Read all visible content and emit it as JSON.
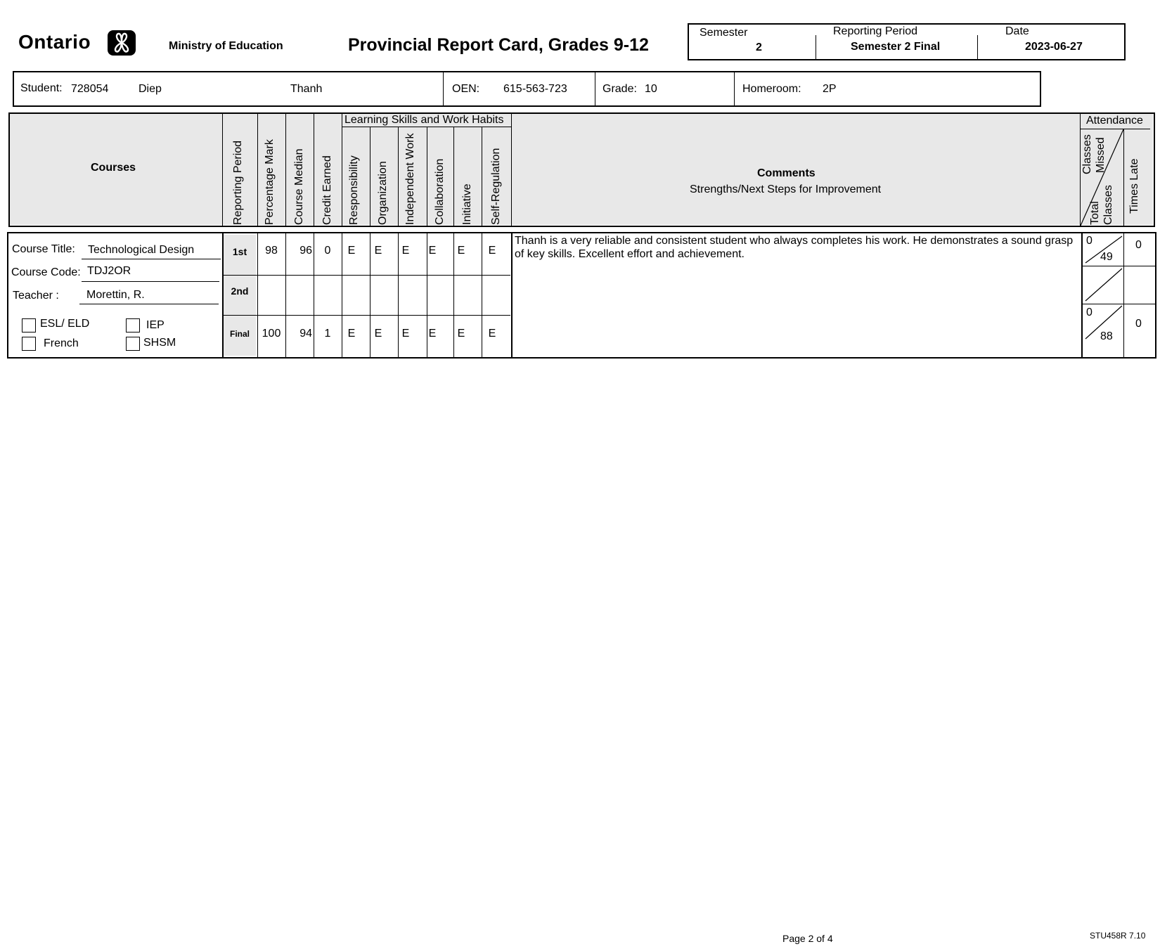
{
  "header": {
    "logo_text": "Ontario",
    "ministry": "Ministry of Education",
    "title": "Provincial Report Card, Grades 9-12",
    "semester_label": "Semester",
    "semester_value": "2",
    "period_label": "Reporting Period",
    "period_value": "Semester 2 Final",
    "date_label": "Date",
    "date_value": "2023-06-27"
  },
  "student": {
    "student_label": "Student:",
    "student_number": "728054",
    "last_name": "Diep",
    "first_name": "Thanh",
    "oen_label": "OEN:",
    "oen_value": "615-563-723",
    "grade_label": "Grade:",
    "grade_value": "10",
    "homeroom_label": "Homeroom:",
    "homeroom_value": "2P"
  },
  "table_header": {
    "courses": "Courses",
    "reporting_period": "Reporting Period",
    "percentage_mark": "Percentage Mark",
    "course_median": "Course Median",
    "credit_earned": "Credit Earned",
    "learning_skills": "Learning Skills and Work Habits",
    "skills": [
      "Responsibility",
      "Organization",
      "Independent Work",
      "Collaboration",
      "Initiative",
      "Self-Regulation"
    ],
    "comments_title": "Comments",
    "comments_sub": "Strengths/Next Steps  for Improvement",
    "attendance": "Attendance",
    "classes_missed_1": "Classes",
    "classes_missed_2": "Missed",
    "total_classes_1": "Total",
    "total_classes_2": "Classes",
    "times_late": "Times Late"
  },
  "course": {
    "title_label": "Course Title:",
    "title_value": "Technological Design",
    "code_label": "Course Code:",
    "code_value": "TDJ2OR",
    "teacher_label": "Teacher :",
    "teacher_value": "Morettin, R.",
    "flags": [
      "ESL/ ELD",
      "IEP",
      "French",
      "SHSM"
    ],
    "rows": [
      {
        "period": "1st",
        "mark": "98",
        "median": "96",
        "credit": "0",
        "skills": [
          "E",
          "E",
          "E",
          "E",
          "E",
          "E"
        ],
        "missed": "0",
        "total": "49",
        "late": "0"
      },
      {
        "period": "2nd",
        "mark": "",
        "median": "",
        "credit": "",
        "skills": [
          "",
          "",
          "",
          "",
          "",
          ""
        ],
        "missed": "",
        "total": "",
        "late": ""
      },
      {
        "period": "Final",
        "mark": "100",
        "median": "94",
        "credit": "1",
        "skills": [
          "E",
          "E",
          "E",
          "E",
          "E",
          "E"
        ],
        "missed": "0",
        "total": "88",
        "late": "0"
      }
    ],
    "comment": "Thanh is a very reliable and consistent student who always completes his work.  He demonstrates a sound grasp of key skills. Excellent effort and achievement."
  },
  "footer": {
    "page": "Page 2  of 4",
    "form_id": "STU458R 7.10"
  }
}
